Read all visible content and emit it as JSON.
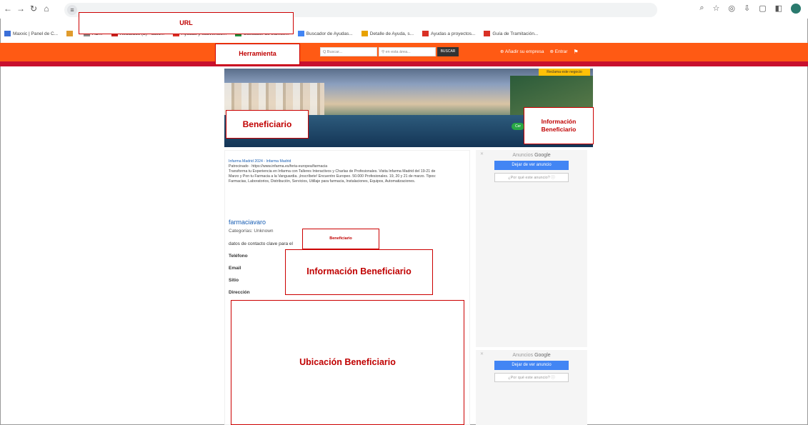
{
  "browser": {
    "bookmarks": [
      {
        "label": "Maxxic | Panel de C...",
        "color": "#3b6fd8"
      },
      {
        "label": "",
        "color": "#e09b2d"
      },
      {
        "label": "AD...",
        "color": "#888888"
      },
      {
        "label": "Recibidos (2) - calic...",
        "color": "#c5221f"
      },
      {
        "label": "Ayudas y subvencio...",
        "color": "#d93025"
      },
      {
        "label": "Buscador de trámite...",
        "color": "#1e8e3e"
      },
      {
        "label": "Buscador de Ayudas...",
        "color": "#4285f4"
      },
      {
        "label": "Detalle de Ayuda, s...",
        "color": "#e8a200"
      },
      {
        "label": "Ayudas a proyectos...",
        "color": "#d93025"
      },
      {
        "label": "Guía de Tramitación...",
        "color": "#d93025"
      }
    ]
  },
  "site": {
    "search_placeholder": "Q Buscar...",
    "location_placeholder": "en esta área...",
    "search_button": "BUSCAR",
    "add_company": "Añadir su empresa",
    "login": "Entrar",
    "claim_badge": "Reclama este negocio",
    "status_pill": "Cer",
    "colors": {
      "header": "#ff5a14",
      "stripe": "#c8102e",
      "link": "#1a5fb4"
    }
  },
  "sponsored": {
    "title": "Infarma Madrid 2024 - Infarma Madrid",
    "line1": "Patrocinado · https://www.infarma.es/feria-europea/farmacia",
    "body": "Transforma tu Experiencia en Infarma con Talleres Interactivos y Charlas de Profesionales. Visita Infarma Madrid del 19-21 de Marzo y Pon tu Farmacia a la Vanguardia. ¡Inscríbete! Encuentro Europeo. 50.000 Profesionales. 19, 20 y 21 de marzo. Tipos: Farmacias, Laboratorios, Distribución, Servicios, Utillaje para farmacia, Instalaciones, Equipos, Automatizaciones."
  },
  "business": {
    "name": "farmaciavaro",
    "category": "Categorías: Unknown",
    "contact_intro": "datos de contacto clave para el",
    "fields": [
      "Teléfono",
      "Email",
      "Sitio",
      "Dirección"
    ]
  },
  "ads": {
    "label_prefix": "Anuncios",
    "label_brand": "Google",
    "stop_button": "Dejar de ver anuncio",
    "why_button": "¿Por qué este anuncio? ⓘ"
  },
  "annotations": {
    "url": "URL",
    "tool": "Herramienta",
    "beneficiary_hero": "Beneficiario",
    "beneficiary_info_hero": "Información Beneficiario",
    "beneficiary_small": "Beneficiario",
    "beneficiary_info": "Información Beneficiario",
    "beneficiary_location": "Ubicación Beneficiario"
  }
}
